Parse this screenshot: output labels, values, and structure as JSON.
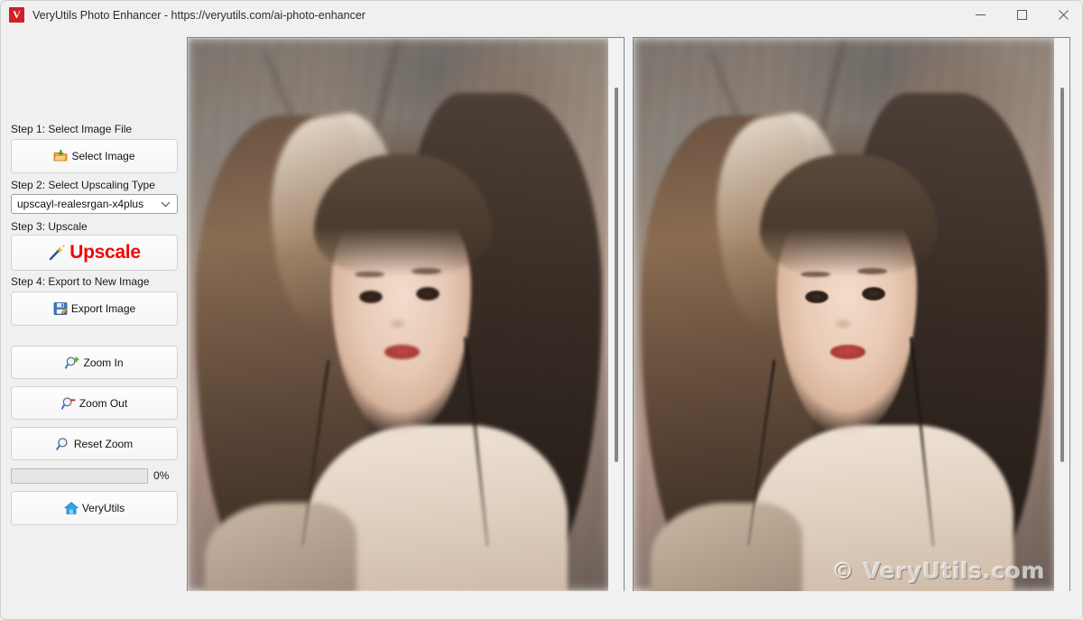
{
  "window": {
    "title": "VeryUtils Photo Enhancer - https://veryutils.com/ai-photo-enhancer",
    "app_icon": "V",
    "icon_color": "#d12027",
    "controls": {
      "minimize": "minimize-icon",
      "maximize": "maximize-icon",
      "close": "close-icon"
    }
  },
  "sidebar": {
    "step1": {
      "label": "Step 1: Select Image File",
      "button": "Select Image",
      "icon": "open-folder-icon"
    },
    "step2": {
      "label": "Step 2: Select Upscaling Type",
      "selected": "upscayl-realesrgan-x4plus",
      "options": [
        "upscayl-realesrgan-x4plus"
      ],
      "icon": "chevron-down-icon"
    },
    "step3": {
      "label": "Step 3: Upscale",
      "button": "Upscale",
      "icon": "magic-wand-icon",
      "color": "#ef0808"
    },
    "step4": {
      "label": "Step 4: Export to New Image",
      "button": "Export Image",
      "icon": "save-image-icon"
    },
    "zoom_in": {
      "label": "Zoom In",
      "icon": "zoom-in-icon"
    },
    "zoom_out": {
      "label": "Zoom Out",
      "icon": "zoom-out-icon"
    },
    "reset_zoom": {
      "label": "Reset Zoom",
      "icon": "magnifier-icon"
    },
    "progress": {
      "value": 0,
      "text": "0%"
    },
    "home": {
      "label": "VeryUtils",
      "icon": "home-icon"
    }
  },
  "viewers": {
    "left": {
      "name": "original-image-preview",
      "scrollbar": "vertical-scrollbar"
    },
    "right": {
      "name": "upscaled-image-preview",
      "scrollbar": "vertical-scrollbar",
      "watermark": "© VeryUtils.com"
    }
  }
}
